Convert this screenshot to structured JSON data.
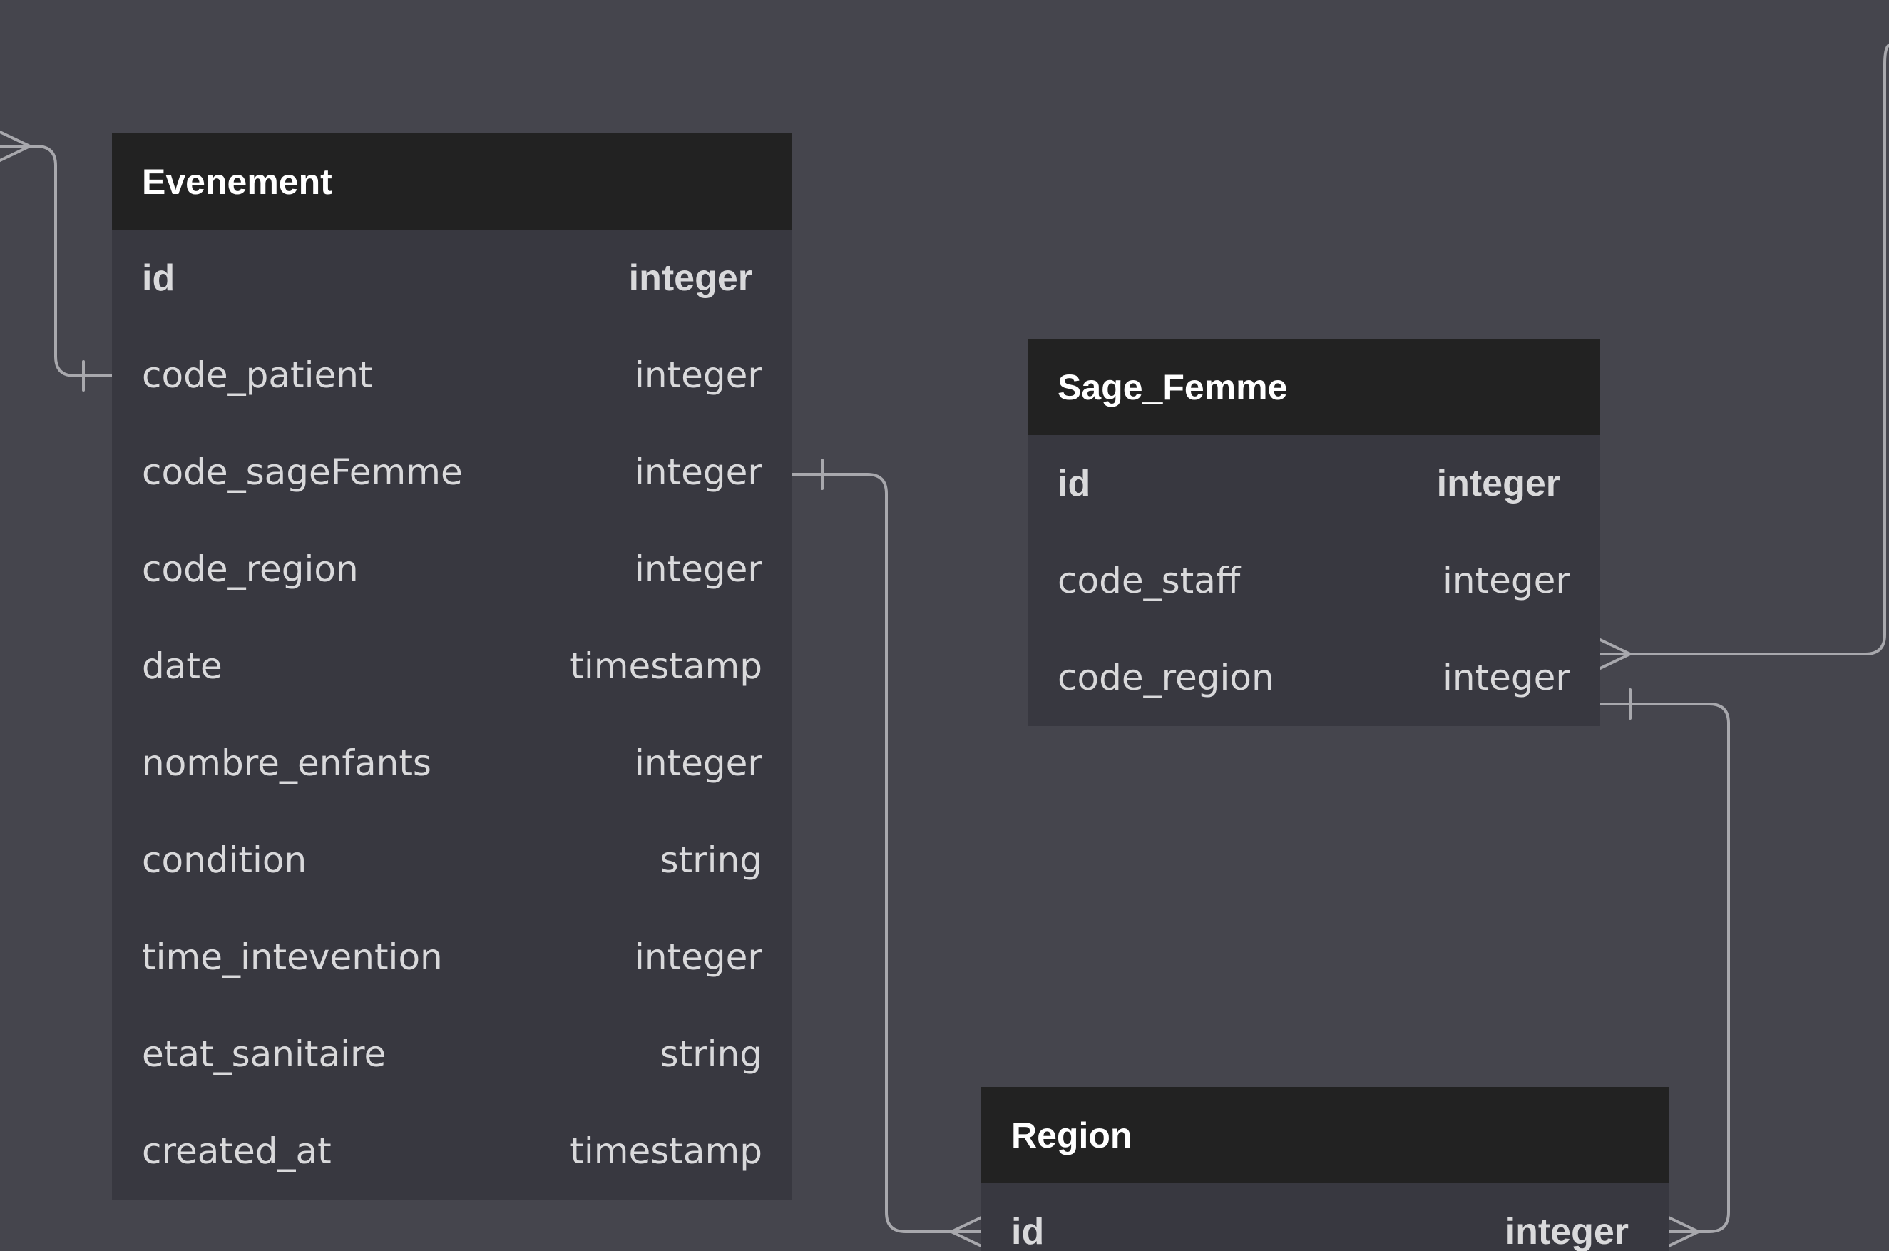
{
  "colors": {
    "canvas": "#45454d",
    "table_body": "#383840",
    "table_header": "#222222",
    "header_text": "#ffffff",
    "field_text": "#d9d9db",
    "connector": "#a8a8ad"
  },
  "tables": [
    {
      "name": "Evenement",
      "fields": [
        {
          "name": "id",
          "type": "integer",
          "primary": true
        },
        {
          "name": "code_patient",
          "type": "integer"
        },
        {
          "name": "code_sageFemme",
          "type": "integer"
        },
        {
          "name": "code_region",
          "type": "integer"
        },
        {
          "name": "date",
          "type": "timestamp"
        },
        {
          "name": "nombre_enfants",
          "type": "integer"
        },
        {
          "name": "condition",
          "type": "string"
        },
        {
          "name": "time_intevention",
          "type": "integer"
        },
        {
          "name": "etat_sanitaire",
          "type": "string"
        },
        {
          "name": "created_at",
          "type": "timestamp"
        }
      ]
    },
    {
      "name": "Sage_Femme",
      "fields": [
        {
          "name": "id",
          "type": "integer",
          "primary": true
        },
        {
          "name": "code_staff",
          "type": "integer"
        },
        {
          "name": "code_region",
          "type": "integer"
        }
      ]
    },
    {
      "name": "Region",
      "fields": [
        {
          "name": "id",
          "type": "integer",
          "primary": true
        }
      ]
    }
  ],
  "relationships": [
    {
      "from": "Evenement.code_patient",
      "to": "offscreen",
      "from_end": "one",
      "to_end": "many"
    },
    {
      "from": "Evenement.code_sageFemme",
      "to": "Region.id",
      "from_end": "one",
      "to_end": "many"
    },
    {
      "from": "Sage_Femme.code_region",
      "to": "Region.id",
      "from_end": "one",
      "to_end": "many"
    },
    {
      "from": "Sage_Femme.code_staff",
      "to": "offscreen",
      "from_end": "many",
      "to_end": "unknown"
    }
  ]
}
